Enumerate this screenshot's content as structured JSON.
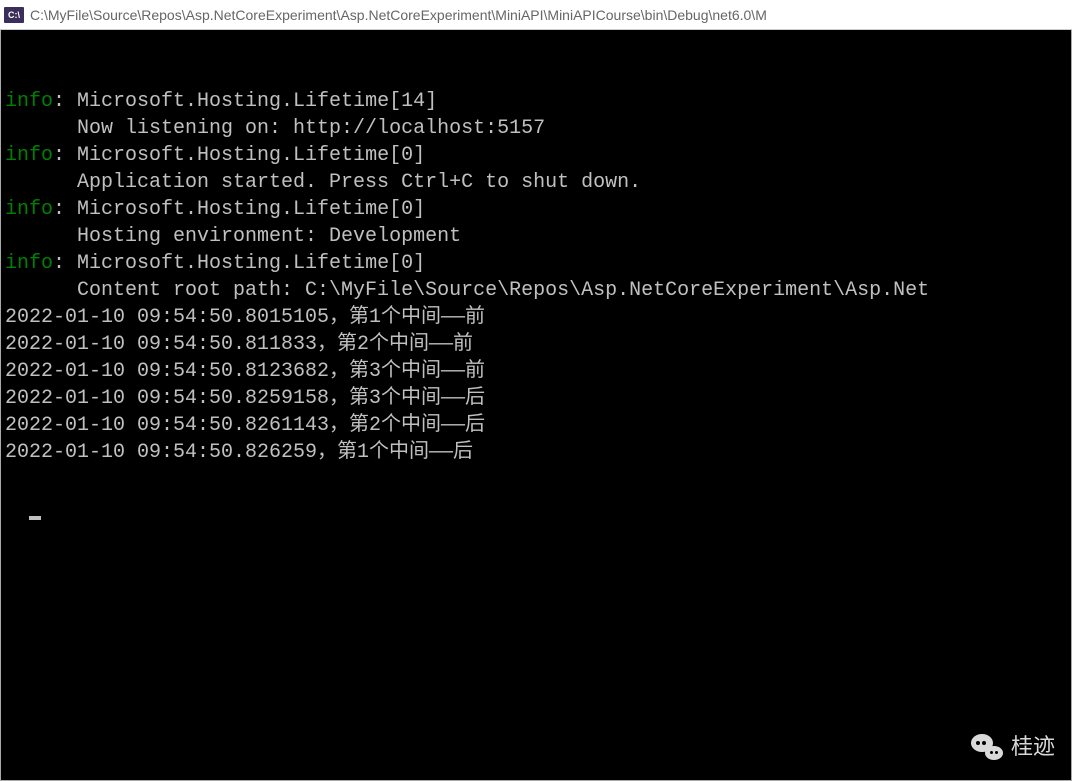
{
  "titlebar": {
    "icon_label": "C:\\",
    "path": "C:\\MyFile\\Source\\Repos\\Asp.NetCoreExperiment\\Asp.NetCoreExperiment\\MiniAPI\\MiniAPICourse\\bin\\Debug\\net6.0\\M"
  },
  "console": {
    "lines": [
      {
        "prefix": "info",
        "text": ": Microsoft.Hosting.Lifetime[14]"
      },
      {
        "prefix": "",
        "text": "      Now listening on: http://localhost:5157"
      },
      {
        "prefix": "info",
        "text": ": Microsoft.Hosting.Lifetime[0]"
      },
      {
        "prefix": "",
        "text": "      Application started. Press Ctrl+C to shut down."
      },
      {
        "prefix": "info",
        "text": ": Microsoft.Hosting.Lifetime[0]"
      },
      {
        "prefix": "",
        "text": "      Hosting environment: Development"
      },
      {
        "prefix": "info",
        "text": ": Microsoft.Hosting.Lifetime[0]"
      },
      {
        "prefix": "",
        "text": "      Content root path: C:\\MyFile\\Source\\Repos\\Asp.NetCoreExperiment\\Asp.Net"
      },
      {
        "prefix": "",
        "text": "2022-01-10 09:54:50.8015105，第1个中间——前"
      },
      {
        "prefix": "",
        "text": "2022-01-10 09:54:50.811833，第2个中间——前"
      },
      {
        "prefix": "",
        "text": "2022-01-10 09:54:50.8123682，第3个中间——前"
      },
      {
        "prefix": "",
        "text": "2022-01-10 09:54:50.8259158，第3个中间——后"
      },
      {
        "prefix": "",
        "text": "2022-01-10 09:54:50.8261143，第2个中间——后"
      },
      {
        "prefix": "",
        "text": "2022-01-10 09:54:50.826259，第1个中间——后"
      }
    ]
  },
  "watermark": {
    "text": "桂迹"
  }
}
